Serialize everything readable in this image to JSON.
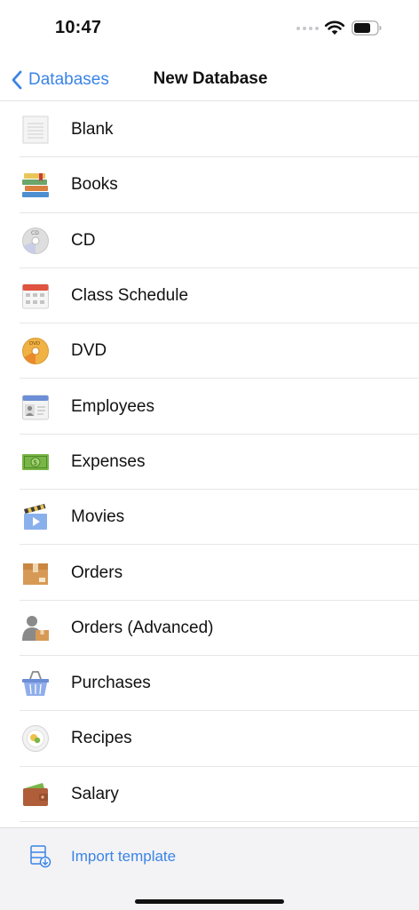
{
  "status_bar": {
    "time": "10:47",
    "icons": [
      "signal-dots-icon",
      "wifi-icon",
      "battery-icon"
    ]
  },
  "nav": {
    "back_label": "Databases",
    "title": "New Database"
  },
  "templates": [
    {
      "label": "Blank",
      "icon": "blank-document-icon"
    },
    {
      "label": "Books",
      "icon": "books-icon"
    },
    {
      "label": "CD",
      "icon": "cd-icon"
    },
    {
      "label": "Class Schedule",
      "icon": "calendar-icon"
    },
    {
      "label": "DVD",
      "icon": "dvd-icon"
    },
    {
      "label": "Employees",
      "icon": "employee-card-icon"
    },
    {
      "label": "Expenses",
      "icon": "money-icon"
    },
    {
      "label": "Movies",
      "icon": "clapperboard-icon"
    },
    {
      "label": "Orders",
      "icon": "box-icon"
    },
    {
      "label": "Orders (Advanced)",
      "icon": "person-box-icon"
    },
    {
      "label": "Purchases",
      "icon": "basket-icon"
    },
    {
      "label": "Recipes",
      "icon": "plate-icon"
    },
    {
      "label": "Salary",
      "icon": "wallet-icon"
    }
  ],
  "toolbar": {
    "import_label": "Import template",
    "import_icon": "import-template-icon"
  },
  "colors": {
    "accent": "#3a84e6",
    "separator": "#e6e6e8",
    "toolbar_bg": "#f3f3f5"
  }
}
